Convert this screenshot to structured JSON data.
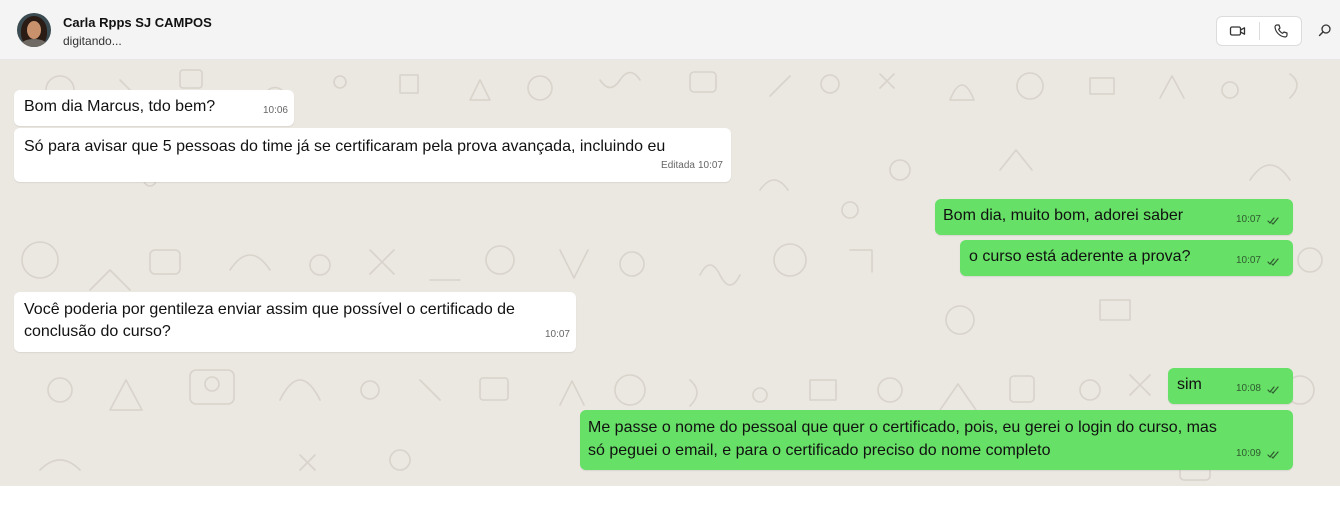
{
  "header": {
    "contact_name": "Carla Rpps SJ CAMPOS",
    "status": "digitando...",
    "icons": [
      "avatar-photo",
      "video-call-icon",
      "voice-call-icon",
      "search-icon"
    ]
  },
  "messages": [
    {
      "direction": "in",
      "text": "Bom dia Marcus, tdo bem?",
      "time": "10:06"
    },
    {
      "direction": "in",
      "text": "Só para avisar que 5 pessoas do time já se certificaram pela prova avançada, incluindo eu",
      "edited_label": "Editada",
      "time": "10:07"
    },
    {
      "direction": "out",
      "text": "Bom dia, muito bom, adorei saber",
      "time": "10:07",
      "read": true
    },
    {
      "direction": "out",
      "text": "o curso está aderente a prova?",
      "time": "10:07",
      "read": true
    },
    {
      "direction": "in",
      "lines": [
        "Você poderia por gentileza enviar assim que possível o certificado de",
        "conclusão do curso?"
      ],
      "time": "10:07"
    },
    {
      "direction": "out",
      "text": "sim",
      "time": "10:08",
      "read": true
    },
    {
      "direction": "out",
      "lines": [
        "Me passe o nome do pessoal que quer o certificado, pois, eu gerei o login do curso, mas",
        "só peguei o email, e para o certificado preciso do nome completo"
      ],
      "time": "10:09",
      "read": true
    }
  ],
  "colors": {
    "incoming_bubble": "#ffffff",
    "outgoing_bubble": "#66e066",
    "chat_background": "#ebe7e1",
    "header_background": "#f4f4f4"
  }
}
